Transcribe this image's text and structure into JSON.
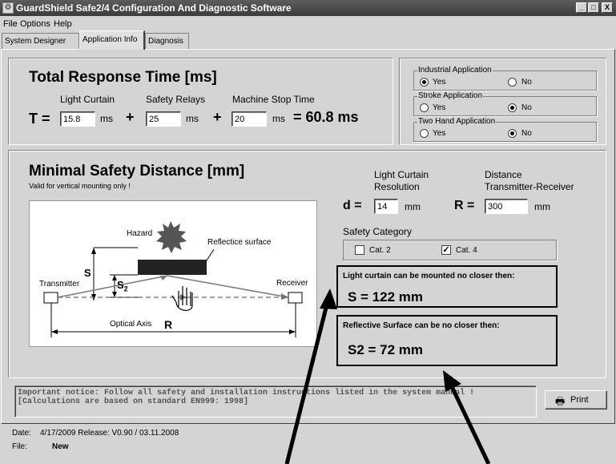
{
  "window": {
    "title": "GuardShield Safe2/4 Configuration And Diagnostic Software",
    "minimize": "_",
    "maximize": "□",
    "close": "X"
  },
  "menu": {
    "items": [
      "File",
      "Options",
      "Help"
    ]
  },
  "tabs": [
    {
      "label": "System Designer",
      "active": false
    },
    {
      "label": "Application Info",
      "active": true
    },
    {
      "label": "Diagnosis",
      "active": false
    }
  ],
  "response_time": {
    "title": "Total Response Time [ms]",
    "col_light_curtain": "Light Curtain",
    "col_safety_relays": "Safety Relays",
    "col_machine_stop": "Machine Stop Time",
    "t_label": "T =",
    "light_curtain_value": "15.8",
    "safety_relays_value": "25",
    "machine_stop_value": "20",
    "unit": "ms",
    "plus": "+",
    "total": "= 60.8 ms"
  },
  "application_options": {
    "industrial": {
      "title": "Industrial Application",
      "yes": "Yes",
      "no": "No",
      "selected": "Yes"
    },
    "stroke": {
      "title": "Stroke Application",
      "yes": "Yes",
      "no": "No",
      "selected": "No"
    },
    "two_hand": {
      "title": "Two Hand Application",
      "yes": "Yes",
      "no": "No",
      "selected": "No"
    }
  },
  "safety_distance": {
    "title": "Minimal Safety Distance [mm]",
    "note": "Valid for vertical mounting only !",
    "resolution_label_1": "Light Curtain",
    "resolution_label_2": "Resolution",
    "distance_label_1": "Distance",
    "distance_label_2": "Transmitter-Receiver",
    "d_label": "d =",
    "d_value": "14",
    "r_label": "R =",
    "r_value": "300",
    "unit": "mm",
    "category_title": "Safety Category",
    "cat2": {
      "label": "Cat. 2",
      "checked": false
    },
    "cat4": {
      "label": "Cat. 4",
      "checked": true
    },
    "result_s_caption": "Light curtain can be mounted no closer then:",
    "result_s_value": "S = 122 mm",
    "result_s2_caption": "Reflective Surface can be no closer then:",
    "result_s2_value": "S2 = 72 mm"
  },
  "diagram": {
    "hazard": "Hazard",
    "reflective_surface": "Reflectice surface",
    "s": "S",
    "s2": "S",
    "s2_sub": "2",
    "transmitter": "Transmitter",
    "receiver": "Receiver",
    "optical_axis": "Optical Axis",
    "r": "R"
  },
  "notice": {
    "line1": "Important notice: Follow all safety and installation instructions listed in the system manual !",
    "line2": "[Calculations are based on standard EN999: 1998]"
  },
  "print_button": "Print",
  "status": {
    "date_label": "Date:",
    "date_value": "4/17/2009  Release: V0.90 / 03.11.2008",
    "file_label": "File:",
    "file_value": "New"
  }
}
